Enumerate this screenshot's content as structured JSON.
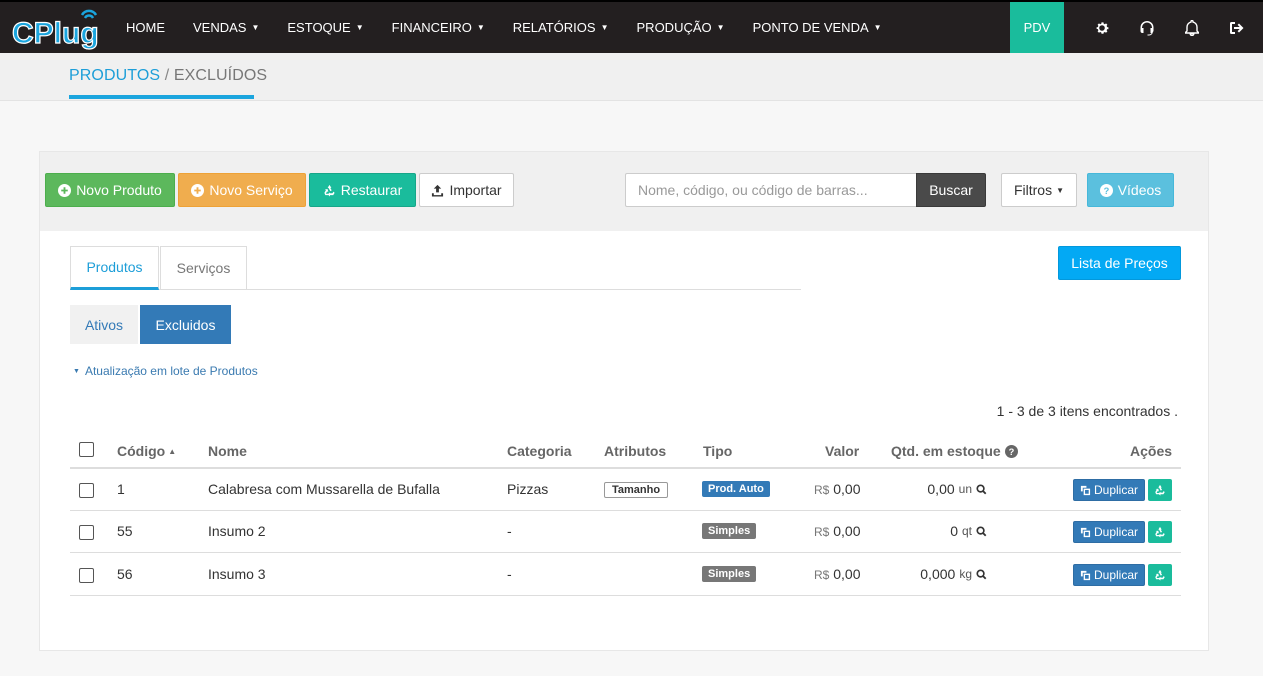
{
  "brand": {
    "logo_text": "CPlug"
  },
  "nav": {
    "items": [
      {
        "label": "HOME",
        "caret": false
      },
      {
        "label": "VENDAS",
        "caret": true
      },
      {
        "label": "ESTOQUE",
        "caret": true
      },
      {
        "label": "FINANCEIRO",
        "caret": true
      },
      {
        "label": "RELATÓRIOS",
        "caret": true
      },
      {
        "label": "PRODUÇÃO",
        "caret": true
      },
      {
        "label": "PONTO DE VENDA",
        "caret": true
      }
    ],
    "pdv_label": "PDV",
    "icons": [
      "gear-icon",
      "headset-icon",
      "bell-icon",
      "logout-icon"
    ]
  },
  "breadcrumb": {
    "part1": "PRODUTOS",
    "separator": " / ",
    "part2": "EXCLUÍDOS"
  },
  "toolbar": {
    "novo_produto": "Novo Produto",
    "novo_servico": "Novo Serviço",
    "restaurar": "Restaurar",
    "importar": "Importar",
    "search_placeholder": "Nome, código, ou código de barras...",
    "buscar": "Buscar",
    "filtros": "Filtros",
    "videos": "Vídeos"
  },
  "lista_precos": "Lista de Preços",
  "tabs": {
    "produtos": "Produtos",
    "servicos": "Serviços"
  },
  "pills": {
    "ativos": "Ativos",
    "excluidos": "Excluidos"
  },
  "batch_link": "Atualização em lote de Produtos",
  "results_count": "1 - 3 de 3 itens encontrados .",
  "table": {
    "headers": {
      "codigo": "Código",
      "nome": "Nome",
      "categoria": "Categoria",
      "atributos": "Atributos",
      "tipo": "Tipo",
      "valor": "Valor",
      "qtd": "Qtd. em estoque",
      "acoes": "Ações"
    },
    "currency": "R$",
    "duplicar_label": "Duplicar",
    "rows": [
      {
        "codigo": "1",
        "nome": "Calabresa com Mussarella de Bufalla",
        "categoria": "Pizzas",
        "atributo": "Tamanho",
        "tipo": "Prod. Auto",
        "tipo_color": "#337ab7",
        "valor": "0,00",
        "qtd": "0,00",
        "unidade": "un"
      },
      {
        "codigo": "55",
        "nome": "Insumo 2",
        "categoria": "-",
        "atributo": "",
        "tipo": "Simples",
        "tipo_color": "#777777",
        "valor": "0,00",
        "qtd": "0",
        "unidade": "qt"
      },
      {
        "codigo": "56",
        "nome": "Insumo 3",
        "categoria": "-",
        "atributo": "",
        "tipo": "Simples",
        "tipo_color": "#777777",
        "valor": "0,00",
        "qtd": "0,000",
        "unidade": "kg"
      }
    ]
  }
}
